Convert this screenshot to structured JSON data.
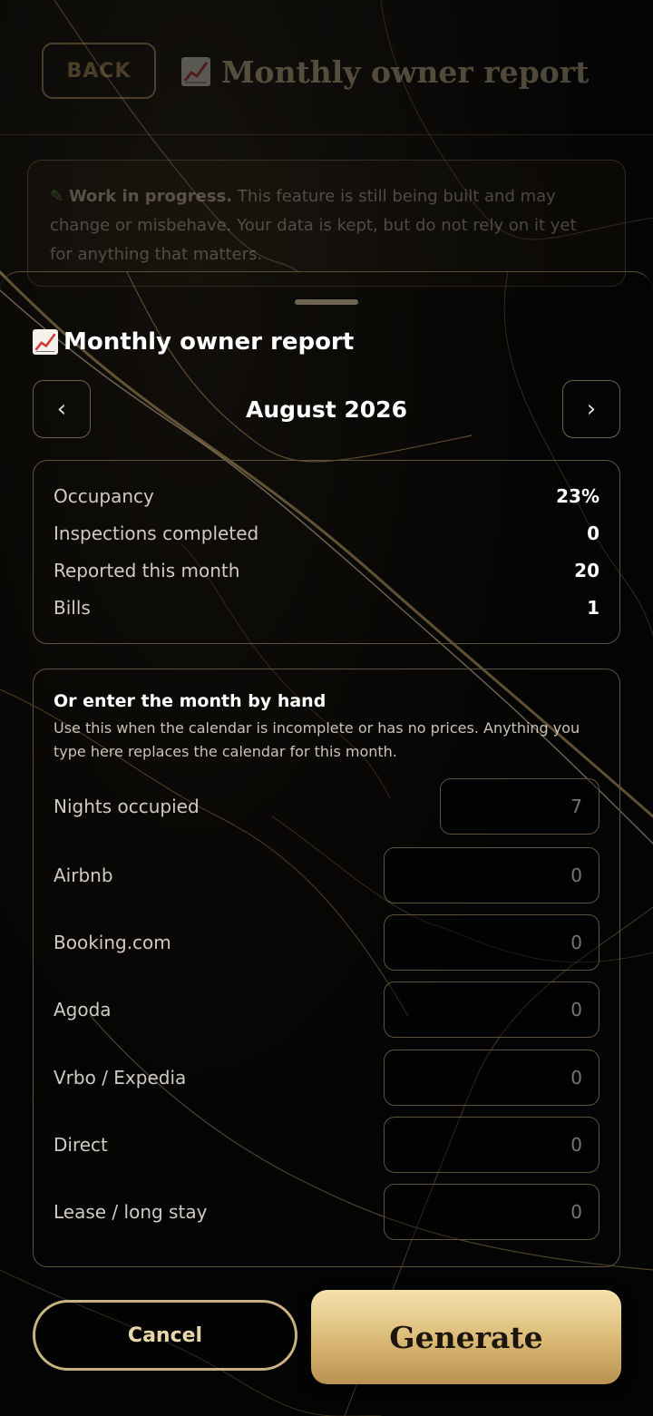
{
  "header": {
    "back_label": "BACK",
    "title": "Monthly owner report"
  },
  "notice": {
    "icon": "pencil-icon",
    "strong": "Work in progress.",
    "text": "This feature is still being built and may change or misbehave. Your data is kept, but do not rely on it yet for anything that matters."
  },
  "sheet": {
    "title": "Monthly owner report",
    "month": "August 2026",
    "prev_label": "‹",
    "next_label": "›"
  },
  "stats": [
    {
      "label": "Occupancy",
      "value": "23%"
    },
    {
      "label": "Inspections completed",
      "value": "0"
    },
    {
      "label": "Reported this month",
      "value": "20"
    },
    {
      "label": "Bills",
      "value": "1"
    }
  ],
  "manual": {
    "heading": "Or enter the month by hand",
    "description": "Use this when the calendar is incomplete or has no prices. Anything you type here replaces the calendar for this month.",
    "fields": [
      {
        "label": "Nights occupied",
        "placeholder": "7"
      },
      {
        "label": "Airbnb",
        "placeholder": "0"
      },
      {
        "label": "Booking.com",
        "placeholder": "0"
      },
      {
        "label": "Agoda",
        "placeholder": "0"
      },
      {
        "label": "Vrbo / Expedia",
        "placeholder": "0"
      },
      {
        "label": "Direct",
        "placeholder": "0"
      },
      {
        "label": "Lease / long stay",
        "placeholder": "0"
      }
    ]
  },
  "actions": {
    "cancel_label": "Cancel",
    "generate_label": "Generate"
  },
  "colors": {
    "accent_gold": "#c9a86a",
    "background": "#000000"
  }
}
